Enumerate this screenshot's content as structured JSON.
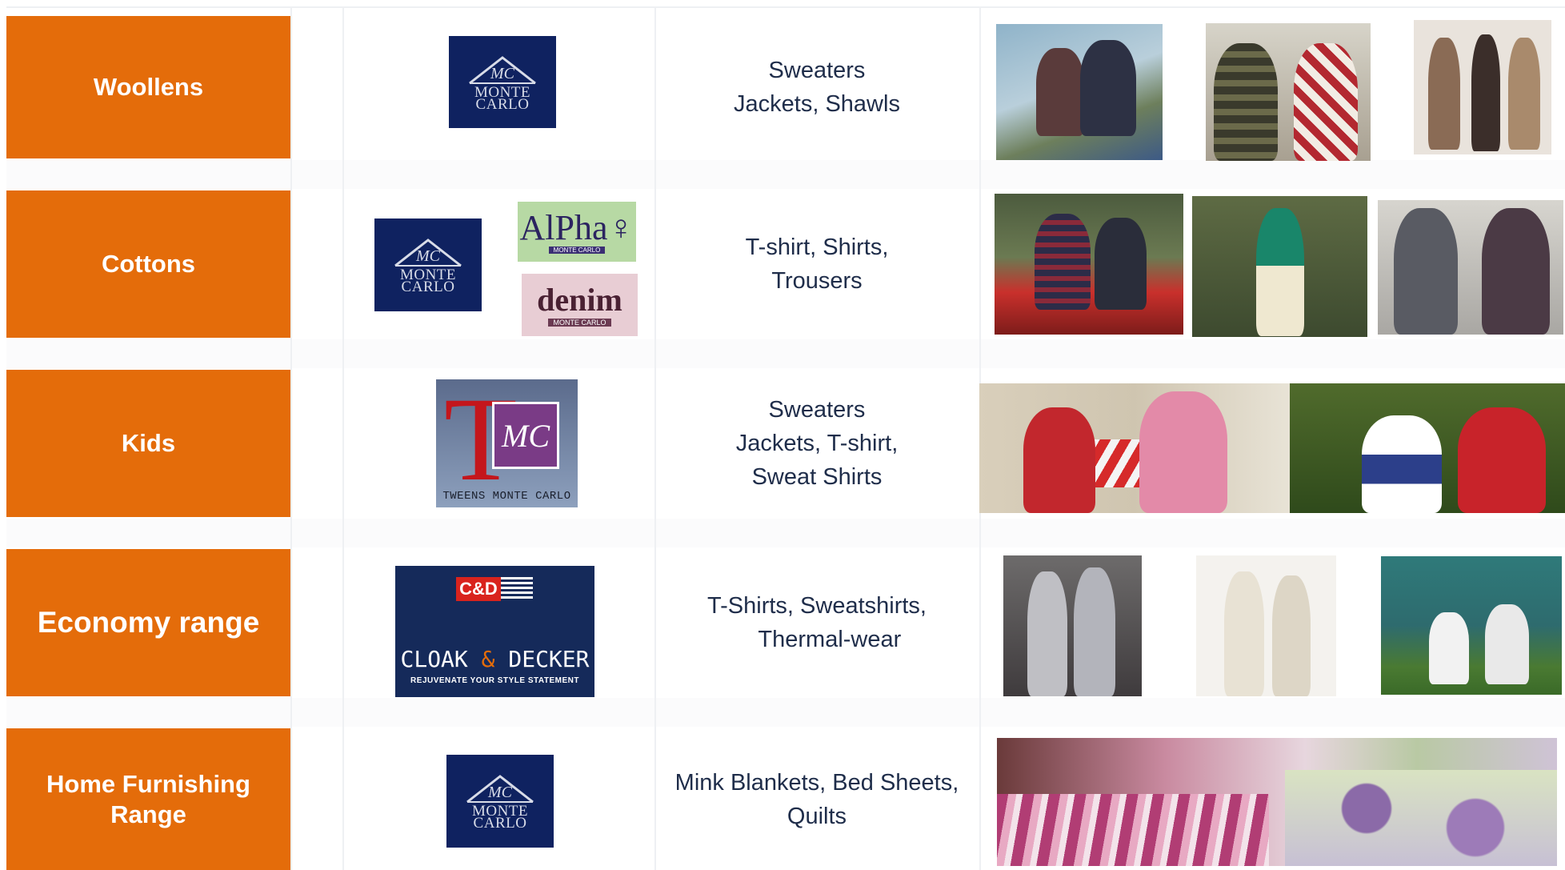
{
  "rows": [
    {
      "category": "Woollens",
      "brand_logo": "MONTE CARLO",
      "products": "Sweaters\nJackets, Shawls"
    },
    {
      "category": "Cottons",
      "brand_logo": "MONTE CARLO",
      "sub_brands": [
        {
          "name": "AlPha",
          "tag": "MONTE CARLO"
        },
        {
          "name": "denim",
          "tag": "MONTE CARLO"
        }
      ],
      "products": "T-shirt, Shirts,\nTrousers"
    },
    {
      "category": "Kids",
      "brand_logo": "TWEENS MONTE CARLO",
      "products": "Sweaters\nJackets, T-shirt,\nSweat Shirts"
    },
    {
      "category": "Economy range",
      "brand_logo": {
        "badge": "C&D",
        "name_left": "CLOAK",
        "amp": "&",
        "name_right": "DECKER",
        "slogan": "REJUVENATE YOUR STYLE STATEMENT"
      },
      "products": "T-Shirts, Sweatshirts,\n    Thermal-wear"
    },
    {
      "category": "Home Furnishing Range",
      "brand_logo": "MONTE CARLO",
      "products": "Mink Blankets, Bed Sheets,\nQuilts"
    }
  ],
  "colors": {
    "category_bg": "#e46c0a",
    "logo_navy": "#0f2260",
    "text": "#1f2d4a"
  },
  "icons": {
    "monte_carlo_mark": "mountain-mc-icon",
    "alpha_mark": "female-symbol-icon"
  }
}
